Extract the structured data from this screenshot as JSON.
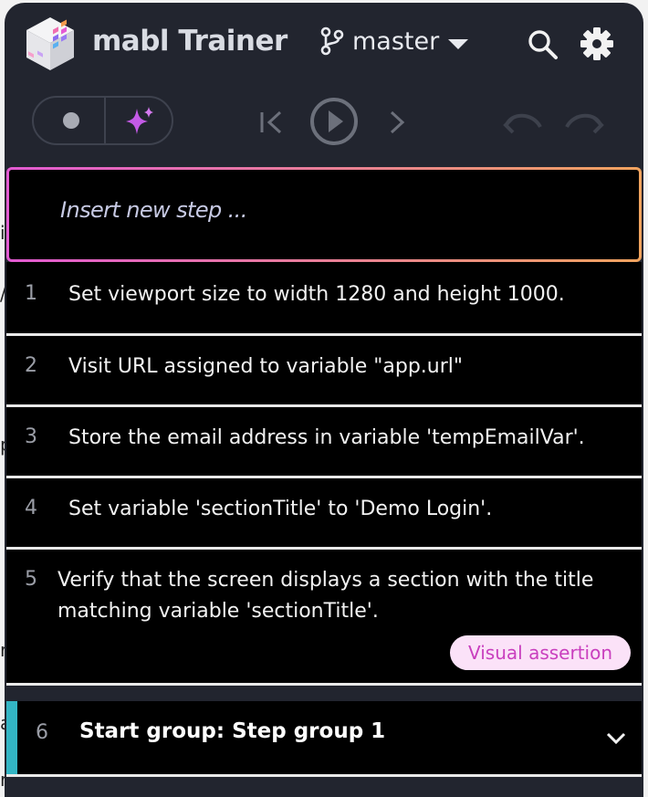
{
  "background": {
    "fragments": [
      "i",
      "/",
      "p",
      "r",
      "a",
      "r"
    ]
  },
  "header": {
    "app_title": "mabl Trainer",
    "branch": "master",
    "icons": [
      "mabl-logo-icon",
      "git-branch-icon",
      "caret-down-icon",
      "search-icon",
      "gear-icon"
    ]
  },
  "toolbar": {
    "icons": [
      "record-icon",
      "sparkle-ai-icon",
      "skip-back-icon",
      "play-icon",
      "step-forward-icon",
      "undo-icon",
      "redo-icon"
    ]
  },
  "insert_step": {
    "placeholder": "Insert new step ..."
  },
  "steps": [
    {
      "num": "1",
      "text": "Set viewport size to width 1280 and height 1000."
    },
    {
      "num": "2",
      "text": "Visit URL assigned to variable \"app.url\""
    },
    {
      "num": "3",
      "text": "Store the email address in variable 'tempEmailVar'."
    },
    {
      "num": "4",
      "text": "Set variable 'sectionTitle' to 'Demo Login'."
    },
    {
      "num": "5",
      "text_line1": "Verify that the screen displays a section with the title",
      "text_line2": "matching variable 'sectionTitle'.",
      "badge": "Visual assertion"
    }
  ],
  "group": {
    "num": "6",
    "title": "Start group: Step group 1"
  },
  "colors": {
    "panel": "#22252f",
    "row": "#000000",
    "accent_pink": "#e25ad2",
    "accent_orange": "#f0a35e",
    "group_stripe": "#33b5c4",
    "badge_bg": "#fbe2f8",
    "badge_text": "#c93fbe"
  }
}
